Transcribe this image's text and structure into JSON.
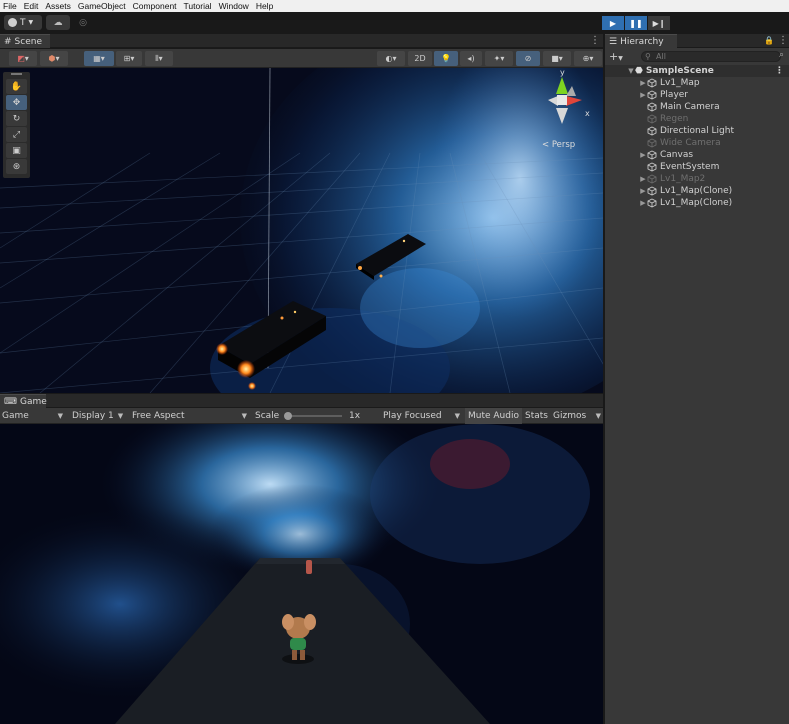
{
  "menu": [
    "File",
    "Edit",
    "Assets",
    "GameObject",
    "Component",
    "Tutorial",
    "Window",
    "Help"
  ],
  "toolbar": {
    "account_label": "T",
    "play_icons": [
      "play-icon",
      "pause-icon",
      "step-icon"
    ]
  },
  "scene_panel": {
    "tab_label": "Scene",
    "toggle_2d": "2D",
    "persp_label": "< Persp",
    "gizmo_axes": [
      "y",
      "x"
    ]
  },
  "game_panel": {
    "tab_label": "Game",
    "view_select": "Game",
    "display_select": "Display 1",
    "aspect_select": "Free Aspect",
    "scale_label": "Scale",
    "scale_value": "1x",
    "scale_slider_fraction": 0.0,
    "play_focused_select": "Play Focused",
    "mute_audio": "Mute Audio",
    "stats": "Stats",
    "gizmos": "Gizmos"
  },
  "hierarchy": {
    "tab_label": "Hierarchy",
    "search_placeholder": "All",
    "scene_name": "SampleScene",
    "items": [
      {
        "label": "Lv1_Map",
        "expandable": true,
        "active": true
      },
      {
        "label": "Player",
        "expandable": true,
        "active": true
      },
      {
        "label": "Main Camera",
        "expandable": false,
        "active": true
      },
      {
        "label": "Regen",
        "expandable": false,
        "active": false
      },
      {
        "label": "Directional Light",
        "expandable": false,
        "active": true
      },
      {
        "label": "Wide Camera",
        "expandable": false,
        "active": false
      },
      {
        "label": "Canvas",
        "expandable": true,
        "active": true
      },
      {
        "label": "EventSystem",
        "expandable": false,
        "active": true
      },
      {
        "label": "Lv1_Map2",
        "expandable": true,
        "active": false
      },
      {
        "label": "Lv1_Map(Clone)",
        "expandable": true,
        "active": true
      },
      {
        "label": "Lv1_Map(Clone)",
        "expandable": true,
        "active": true
      }
    ]
  },
  "colors": {
    "play_active": "#2f6fb1",
    "panel_bg": "#383838",
    "window_bg": "#191919"
  }
}
